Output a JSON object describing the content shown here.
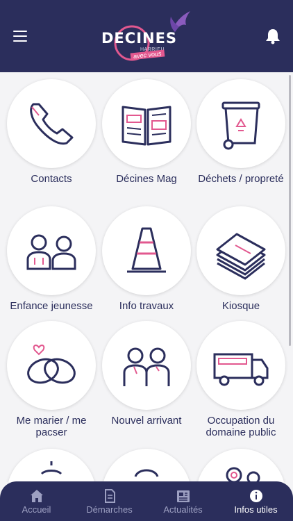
{
  "header": {
    "logo_text": "DECINES",
    "logo_sub1": "HARRIEU",
    "logo_sub2": "avec vous"
  },
  "tiles": [
    {
      "label": "Contacts",
      "icon": "phone-icon"
    },
    {
      "label": "Décines Mag",
      "icon": "magazine-icon"
    },
    {
      "label": "Déchets / propreté",
      "icon": "recycle-bin-icon"
    },
    {
      "label": "Enfance jeunesse",
      "icon": "family-icon"
    },
    {
      "label": "Info travaux",
      "icon": "traffic-cone-icon"
    },
    {
      "label": "Kiosque",
      "icon": "documents-stack-icon"
    },
    {
      "label": "Me marier / me pacser",
      "icon": "wedding-rings-icon"
    },
    {
      "label": "Nouvel arrivant",
      "icon": "couple-icon"
    },
    {
      "label": "Occupation du domaine public",
      "icon": "food-truck-icon"
    }
  ],
  "tabs": [
    {
      "label": "Accueil",
      "icon": "home-icon",
      "active": false
    },
    {
      "label": "Démarches",
      "icon": "document-icon",
      "active": false
    },
    {
      "label": "Actualités",
      "icon": "newspaper-icon",
      "active": false
    },
    {
      "label": "Infos utiles",
      "icon": "info-icon",
      "active": true
    }
  ],
  "colors": {
    "navy": "#2b2e5c",
    "pink": "#e2588f",
    "background": "#f4f4f6"
  }
}
